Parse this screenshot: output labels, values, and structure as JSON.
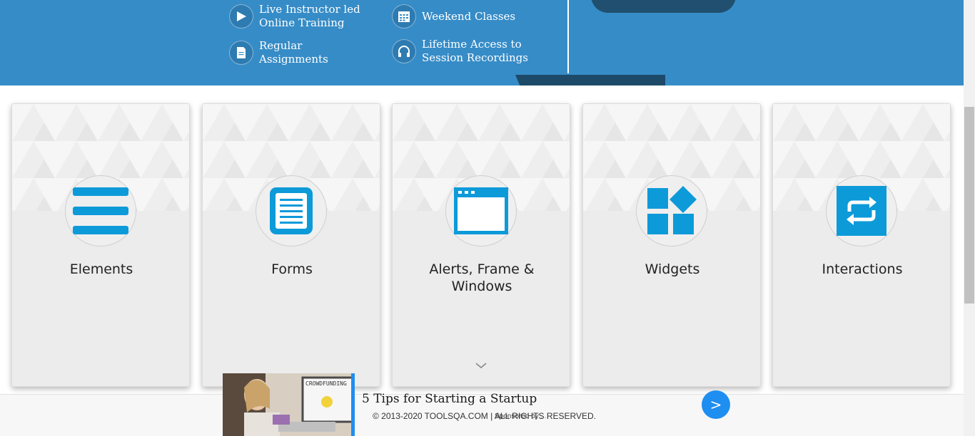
{
  "banner": {
    "features": [
      {
        "label": "Live Instructor led\nOnline Training",
        "icon": "play-icon"
      },
      {
        "label": "Weekend Classes",
        "icon": "calendar-icon"
      },
      {
        "label": "Regular\nAssignments",
        "icon": "document-icon"
      },
      {
        "label": "Lifetime Access to\nSession Recordings",
        "icon": "headphones-icon"
      }
    ],
    "colors": {
      "background": "#368cc7",
      "dark": "#204f6f"
    }
  },
  "cards": [
    {
      "title": "Elements",
      "icon": "hamburger-menu-icon"
    },
    {
      "title": "Forms",
      "icon": "form-document-icon"
    },
    {
      "title": "Alerts, Frame & Windows",
      "icon": "browser-window-icon"
    },
    {
      "title": "Widgets",
      "icon": "widgets-icon"
    },
    {
      "title": "Interactions",
      "icon": "swap-arrows-icon"
    }
  ],
  "footer": {
    "copyright": "© 2013-2020 TOOLSQA.COM | ALL RIGHTS RESERVED."
  },
  "ad": {
    "headline": "5 Tips for Starting a Startup",
    "sponsored_label": "Sponsored by",
    "sponsor_brand": "...",
    "button_label": ">",
    "image_text": "CROWDFUNDING",
    "accent_color": "#1e8ef0"
  },
  "accent_color": "#0d9ad9"
}
